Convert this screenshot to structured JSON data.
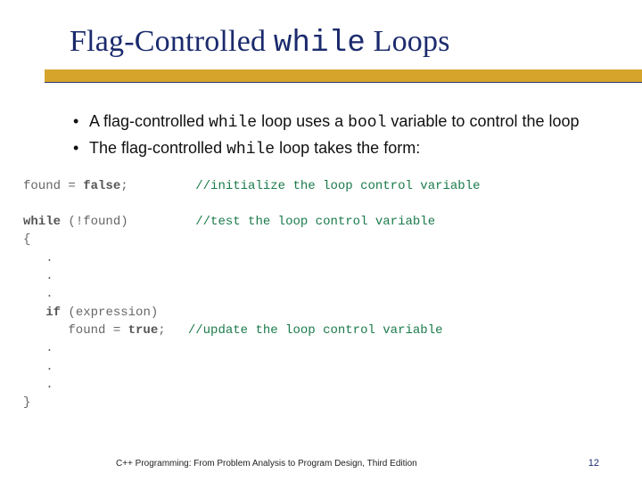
{
  "title": {
    "pre": "Flag-Controlled ",
    "mono": "while",
    "post": " Loops"
  },
  "bullets": [
    {
      "parts": [
        {
          "t": "A flag-controlled "
        },
        {
          "t": "while",
          "mono": true
        },
        {
          "t": " loop uses a "
        },
        {
          "t": "bool",
          "mono": true
        },
        {
          "t": " variable to control the loop"
        }
      ]
    },
    {
      "parts": [
        {
          "t": "The flag-controlled "
        },
        {
          "t": "while",
          "mono": true
        },
        {
          "t": " loop takes the form:"
        }
      ]
    }
  ],
  "code": [
    [
      {
        "t": "found = "
      },
      {
        "t": "false",
        "kw": true
      },
      {
        "t": ";         "
      },
      {
        "t": "//initialize the loop control variable",
        "cm": true
      }
    ],
    [
      {
        "t": ""
      }
    ],
    [
      {
        "t": "while",
        "kw": true
      },
      {
        "t": " (!found)         "
      },
      {
        "t": "//test the loop control variable",
        "cm": true
      }
    ],
    [
      {
        "t": "{"
      }
    ],
    [
      {
        "t": "   ."
      }
    ],
    [
      {
        "t": "   ."
      }
    ],
    [
      {
        "t": "   ."
      }
    ],
    [
      {
        "t": "   "
      },
      {
        "t": "if",
        "kw": true
      },
      {
        "t": " (expression)"
      }
    ],
    [
      {
        "t": "      found = "
      },
      {
        "t": "true",
        "kw": true
      },
      {
        "t": ";   "
      },
      {
        "t": "//update the loop control variable",
        "cm": true
      }
    ],
    [
      {
        "t": "   ."
      }
    ],
    [
      {
        "t": "   ."
      }
    ],
    [
      {
        "t": "   ."
      }
    ],
    [
      {
        "t": "}"
      }
    ]
  ],
  "footer": {
    "text": "C++ Programming: From Problem Analysis to Program Design, Third Edition",
    "page": "12"
  }
}
